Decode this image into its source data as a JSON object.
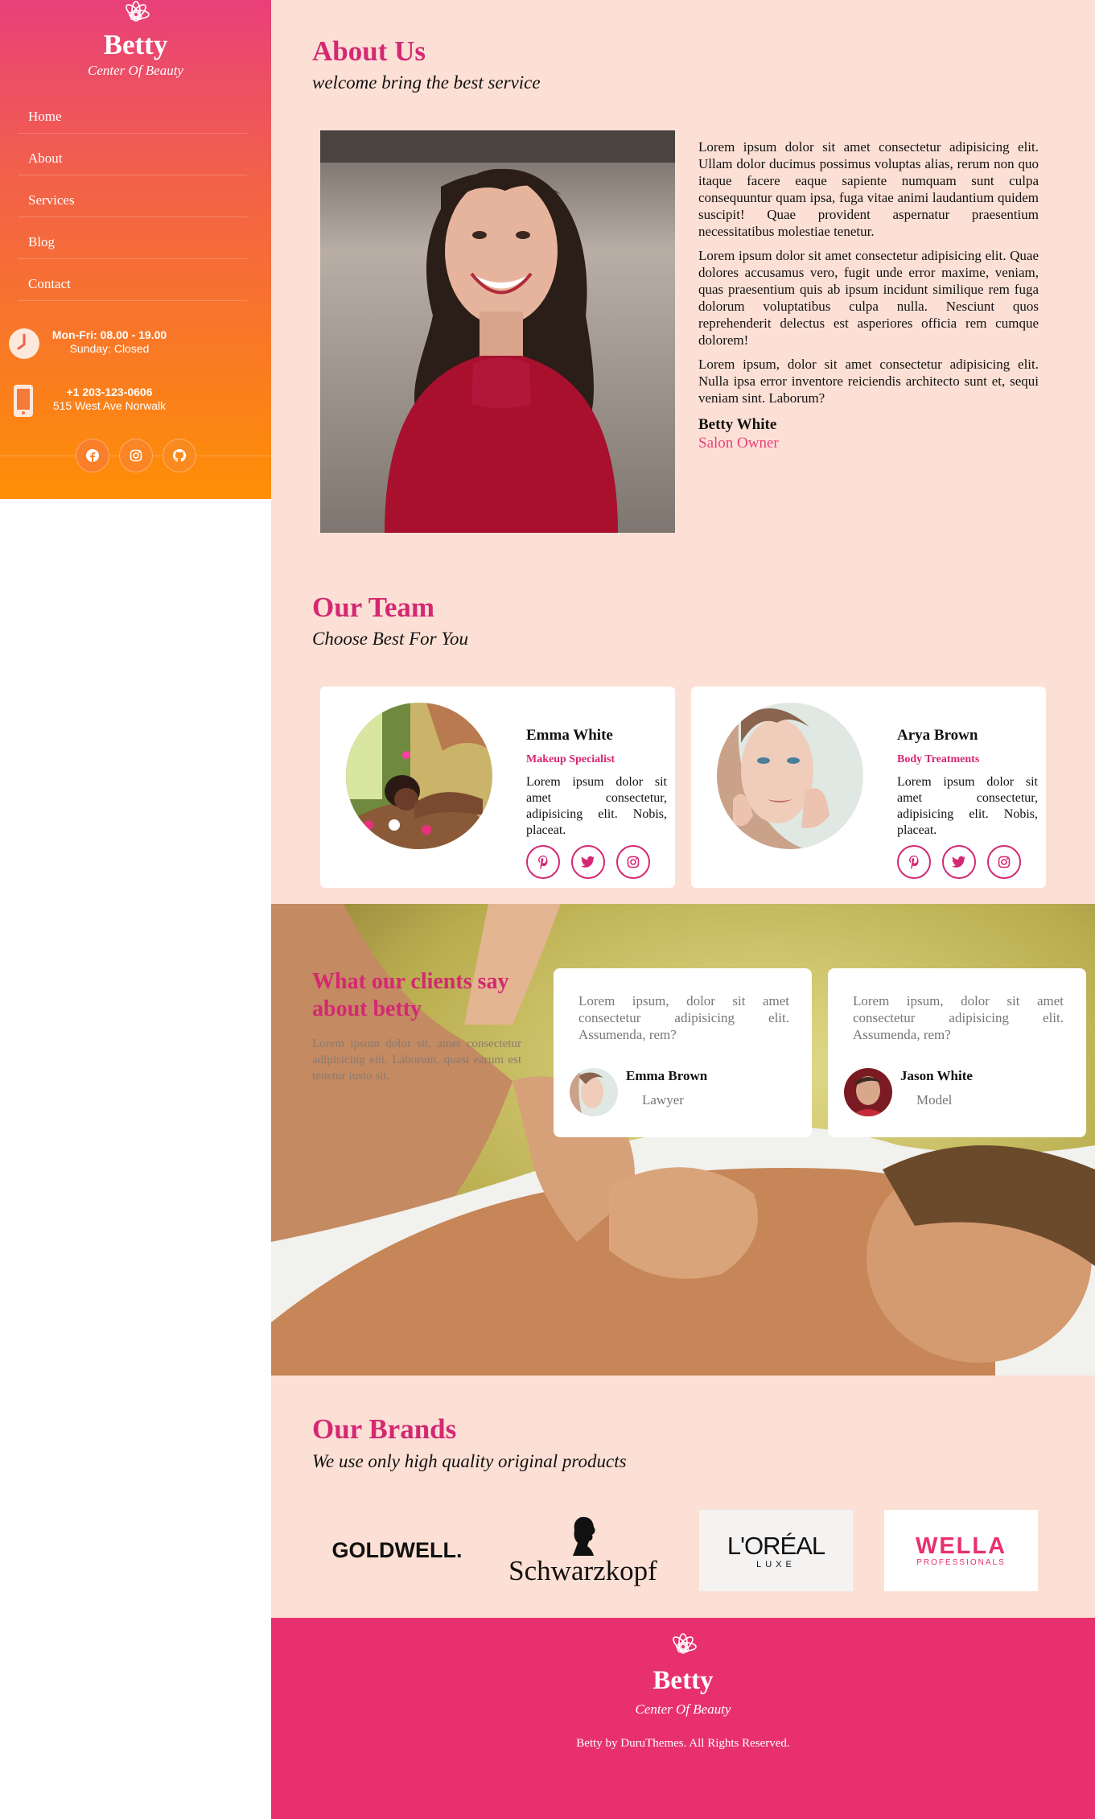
{
  "sidebar": {
    "brand": "Betty",
    "tagline": "Center Of Beauty",
    "nav": [
      "Home",
      "About",
      "Services",
      "Blog",
      "Contact"
    ],
    "hours": {
      "line1": "Mon-Fri: 08.00 - 19.00",
      "line2": "Sunday: Closed"
    },
    "contact": {
      "phone": "+1 203-123-0606",
      "address": "515 West Ave Norwalk"
    },
    "socials": [
      "facebook-icon",
      "instagram-icon",
      "github-icon"
    ]
  },
  "about": {
    "title": "About Us",
    "subtitle": "welcome bring the best service",
    "paragraphs": [
      "Lorem ipsum dolor sit amet consectetur adipisicing elit. Ullam dolor ducimus possimus voluptas alias, rerum non quo itaque facere eaque sapiente numquam sunt culpa consequuntur quam ipsa, fuga vitae animi laudantium quidem suscipit! Quae provident aspernatur praesentium necessitatibus molestiae tenetur.",
      "Lorem ipsum dolor sit amet consectetur adipisicing elit. Quae dolores accusamus vero, fugit unde error maxime, veniam, quas praesentium quis ab ipsum incidunt similique rem fuga dolorum voluptatibus culpa nulla. Nesciunt quos reprehenderit delectus est asperiores officia rem cumque dolorem!",
      "Lorem ipsum, dolor sit amet consectetur adipisicing elit. Nulla ipsa error inventore reiciendis architecto sunt et, sequi veniam sint. Laborum?"
    ],
    "owner_name": "Betty White",
    "owner_role": "Salon Owner"
  },
  "team": {
    "title": "Our Team",
    "subtitle": "Choose Best For You",
    "members": [
      {
        "name": "Emma White",
        "role": "Makeup Specialist",
        "desc": "Lorem ipsum dolor sit amet consectetur, adipisicing elit. Nobis, placeat."
      },
      {
        "name": "Arya Brown",
        "role": "Body Treatments",
        "desc": "Lorem ipsum dolor sit amet consectetur, adipisicing elit. Nobis, placeat."
      }
    ]
  },
  "testimonials": {
    "heading": "What our clients say about betty",
    "intro": "Lorem ipsum dolor sit, amet consectetur adipisicing elit. Laborum, quasi earum est tenetur iusto sit.",
    "items": [
      {
        "quote": "Lorem ipsum, dolor sit amet consectetur adipisicing elit. Assumenda, rem?",
        "name": "Emma Brown",
        "job": "Lawyer"
      },
      {
        "quote": "Lorem ipsum, dolor sit amet consectetur adipisicing elit. Assumenda, rem?",
        "name": "Jason White",
        "job": "Model"
      }
    ]
  },
  "brands": {
    "title": "Our Brands",
    "subtitle": "We use only high quality original products",
    "logos": [
      "GOLDWELL.",
      "Schwarzkopf",
      "L'ORÉAL",
      "LUXE",
      "WELLA",
      "PROFESSIONALS"
    ]
  },
  "footer": {
    "brand": "Betty",
    "tagline": "Center Of Beauty",
    "copyright": "Betty by DuruThemes. All Rights Reserved."
  },
  "colors": {
    "accent": "#d42873",
    "footer": "#e8306f",
    "page_bg": "#fde0d5",
    "sidebar_top": "#e8407a",
    "sidebar_bottom": "#ff8f05"
  }
}
